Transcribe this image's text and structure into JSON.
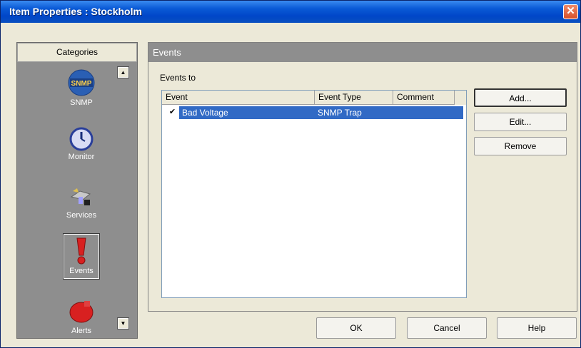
{
  "window": {
    "title": "Item Properties : Stockholm",
    "close_glyph": "✕"
  },
  "categories": {
    "header": "Categories",
    "items": [
      {
        "label": "SNMP",
        "icon": "snmp-icon"
      },
      {
        "label": "Monitor",
        "icon": "monitor-clock-icon"
      },
      {
        "label": "Services",
        "icon": "services-icon"
      },
      {
        "label": "Events",
        "icon": "events-exclamation-icon",
        "selected": true
      },
      {
        "label": "Alerts",
        "icon": "alerts-icon"
      }
    ],
    "scroll_up": "▲",
    "scroll_down": "▼"
  },
  "events": {
    "header": "Events",
    "events_to_label": "Events to",
    "columns": [
      "Event",
      "Event Type",
      "Comment"
    ],
    "rows": [
      {
        "checked": true,
        "event": "Bad Voltage",
        "event_type": "SNMP Trap",
        "comment": ""
      }
    ],
    "check_glyph": "✔"
  },
  "side_buttons": {
    "add": "Add...",
    "edit": "Edit...",
    "remove": "Remove"
  },
  "footer": {
    "ok": "OK",
    "cancel": "Cancel",
    "help": "Help"
  },
  "colors": {
    "title_bar": "#0046c8",
    "selection": "#316ac5",
    "sidebar": "#8e8e8e"
  }
}
